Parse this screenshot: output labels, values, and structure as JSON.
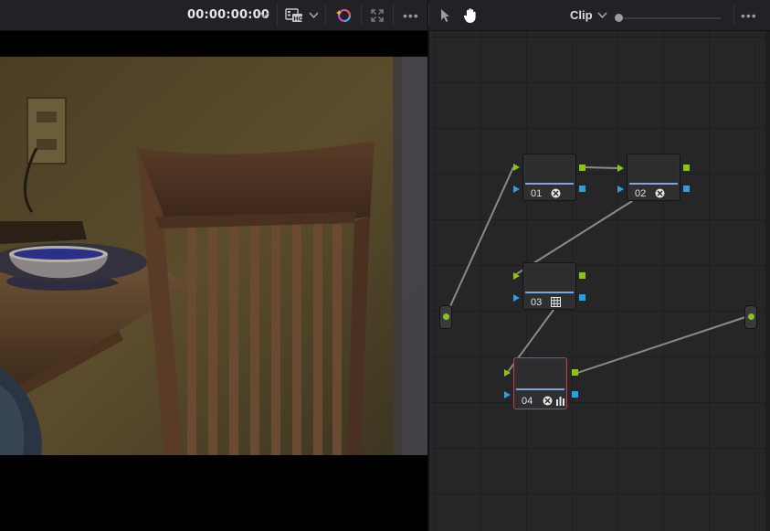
{
  "toolbar": {
    "timecode": "00:00:00:00",
    "clip_label": "Clip",
    "more_label": "•••"
  },
  "nodes": [
    {
      "label": "01",
      "icons": [
        "fx-icon"
      ]
    },
    {
      "label": "02",
      "icons": [
        "fx-icon"
      ]
    },
    {
      "label": "03",
      "icons": [
        "grid-icon"
      ]
    },
    {
      "label": "04",
      "icons": [
        "fx-icon",
        "levels-icon"
      ],
      "selected": true
    }
  ],
  "colors": {
    "rgb_port": "#8cc21b",
    "alpha_port": "#2f9ee0",
    "selected_border": "#d23b3b",
    "node_bar": "#7fa6d8"
  }
}
